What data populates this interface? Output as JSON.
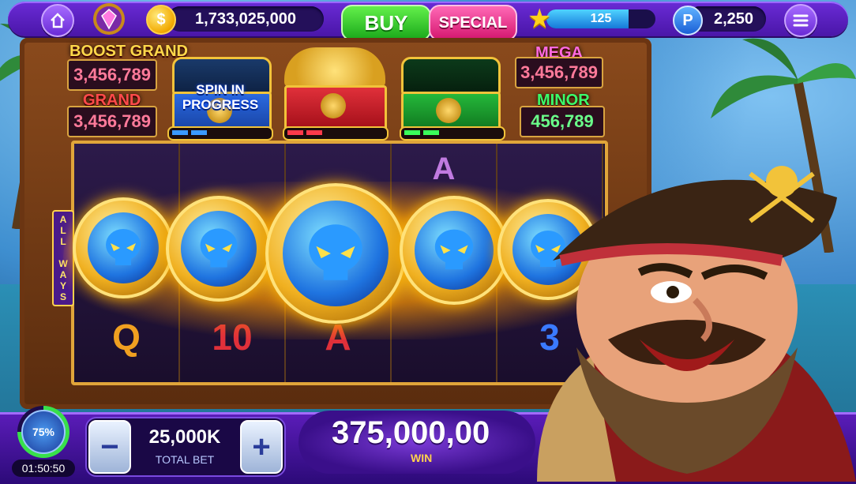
{
  "header": {
    "coins": "1,733,025,000",
    "buy_label": "BUY",
    "special_label": "SPECIAL",
    "level": "125",
    "level_progress": 0.75,
    "points": "2,250",
    "coin_symbol": "$",
    "points_symbol": "P"
  },
  "jackpots": {
    "boost_grand": {
      "label": "BOOST GRAND",
      "value": "3,456,789"
    },
    "grand": {
      "label": "GRAND",
      "value": "3,456,789"
    },
    "mega": {
      "label": "MEGA",
      "value": "3,456,789"
    },
    "minor": {
      "label": "MINOR",
      "value": "456,789"
    }
  },
  "chests": {
    "spin_status": "SPIN IN PROGRESS"
  },
  "reels": {
    "side_label": "ALL WAYS",
    "visible_symbols": [
      "Q",
      "10",
      "A",
      "A",
      "3"
    ]
  },
  "footer": {
    "timer_percent": "75%",
    "timer_time": "01:50:50",
    "total_bet": "25,000K",
    "total_bet_label": "TOTAL BET",
    "win_amount": "375,000,00",
    "win_label": "WIN",
    "minus_symbol": "−",
    "plus_symbol": "+"
  },
  "colors": {
    "accent_purple": "#6a2bd6",
    "buy_green": "#1aa81a",
    "special_pink": "#d4166e",
    "gold": "#f2c33a"
  }
}
